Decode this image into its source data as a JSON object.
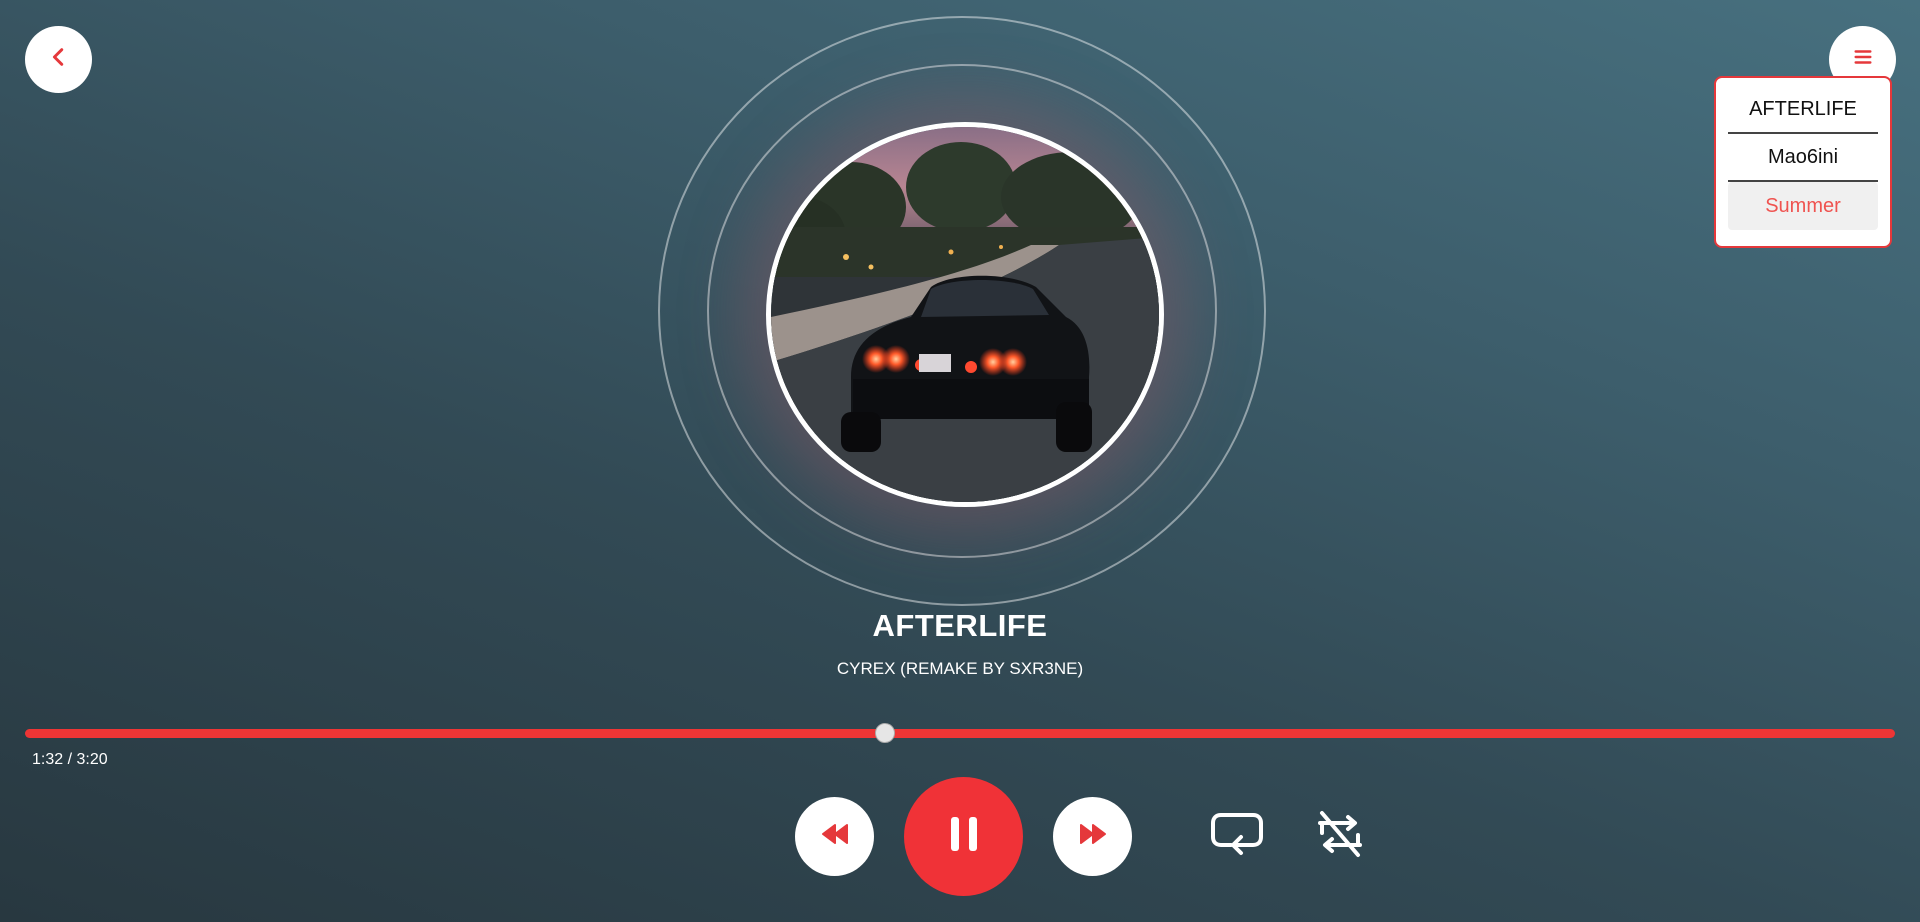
{
  "header": {
    "back_icon": "chevron-left-icon",
    "menu_icon": "hamburger-menu-icon"
  },
  "playlist": {
    "items": [
      {
        "label": "AFTERLIFE",
        "active": false
      },
      {
        "label": "Mao6ini",
        "active": false
      },
      {
        "label": "Summer",
        "active": true
      }
    ]
  },
  "track": {
    "title": "AFTERLIFE",
    "artist": "CYREX (REMAKE BY SXR3NE)",
    "time_display": "1:32 / 3:20",
    "progress": 0.46
  },
  "controls": {
    "prev_icon": "rewind-icon",
    "pause_icon": "pause-icon",
    "next_icon": "fast-forward-icon",
    "repeat_icon": "repeat-icon",
    "shuffle_icon": "shuffle-off-icon"
  },
  "colors": {
    "accent": "#f03237",
    "active_item": "#ef5350",
    "background_dark": "#283840",
    "background_light": "#47707f"
  }
}
